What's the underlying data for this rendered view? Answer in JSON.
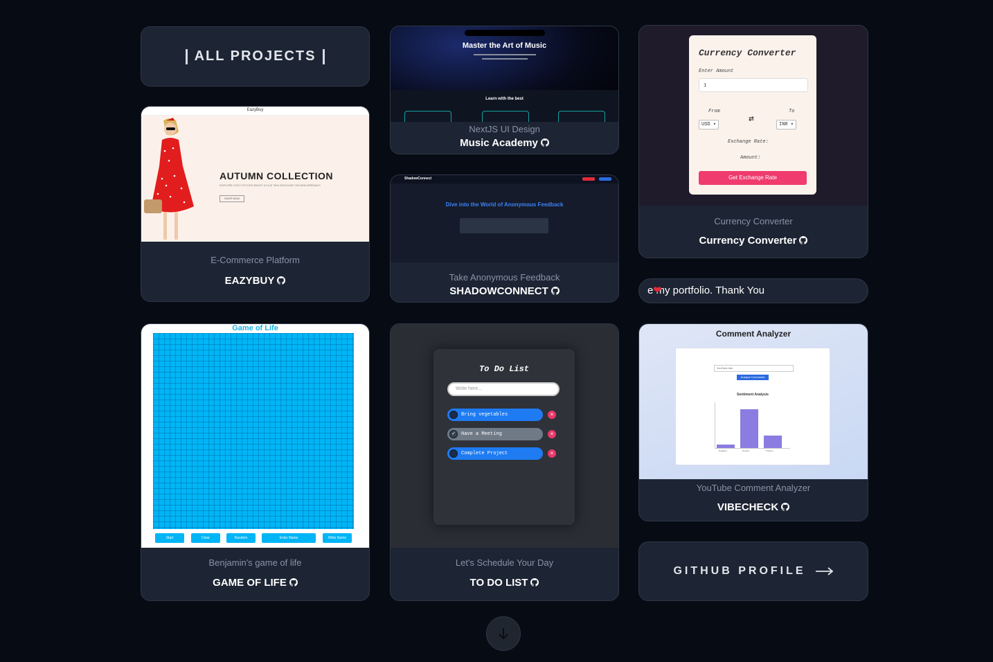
{
  "all_projects": {
    "label": "ALL PROJECTS"
  },
  "projects": {
    "music": {
      "subtitle": "NextJS UI Design",
      "title": "Music Academy",
      "preview": {
        "heading": "Master the Art of Music",
        "section": "Learn with the best"
      }
    },
    "currency": {
      "subtitle": "Currency Converter",
      "title": "Currency Converter",
      "preview": {
        "heading": "Currency Converter",
        "enter_amount": "Enter Amount",
        "amount_value": "1",
        "from_label": "From",
        "to_label": "To",
        "from_currency": "USD",
        "to_currency": "INR",
        "rate_label": "Exchange Rate:",
        "amount_label": "Amount:",
        "button": "Get Exchange Rate"
      }
    },
    "eazybuy": {
      "subtitle": "E-Commerce Platform",
      "title": "EAZYBUY",
      "preview": {
        "brand": "EazyBuy",
        "heading": "AUTUMN COLLECTION",
        "desc": "EXPLORE COZY STYLES! ENJOY A FLAT 30% DISCOUNT ON NEW ARRIVALS",
        "button": "SHOP NOW"
      }
    },
    "shadowconnect": {
      "subtitle": "Take Anonymous Feedback",
      "title": "SHADOWCONNECT",
      "preview": {
        "logo": "ShadowConnect",
        "heading": "Dive into the World of Anonymous Feedback"
      }
    },
    "gameoflife": {
      "subtitle": "Benjamin's game of life",
      "title": "GAME OF LIFE",
      "preview": {
        "heading": "Game of Life",
        "buttons": [
          "Start",
          "Clear",
          "Random",
          "Enter Name",
          "Write Name"
        ]
      }
    },
    "todo": {
      "subtitle": "Let's Schedule Your Day",
      "title": "TO DO LIST",
      "preview": {
        "heading": "To Do List",
        "placeholder": "Write here...",
        "items": [
          "Bring vegetables",
          "Have a Meeting",
          "Complete Project"
        ]
      }
    },
    "vibecheck": {
      "subtitle": "YouTube Comment Analyzer",
      "title": "VIBECHECK",
      "preview": {
        "heading": "Comment Analyzer",
        "input": "YouTube link",
        "button": "Analyze Comments",
        "chart_title": "Sentiment Analysis",
        "bar_labels": [
          "Negative",
          "Neutral",
          "Positive"
        ]
      }
    }
  },
  "marquee": {
    "text": "e my portfolio. Thank You",
    "icon": "heart-icon"
  },
  "github_profile": {
    "label": "GITHUB PROFILE",
    "icon": "arrow-right-icon"
  },
  "scroll_button": {
    "icon": "arrow-down-icon"
  },
  "colors": {
    "background": "#070b14",
    "card": "#1d2433",
    "accent_blue": "#00b5f6",
    "accent_pink": "#ef3b6e"
  }
}
